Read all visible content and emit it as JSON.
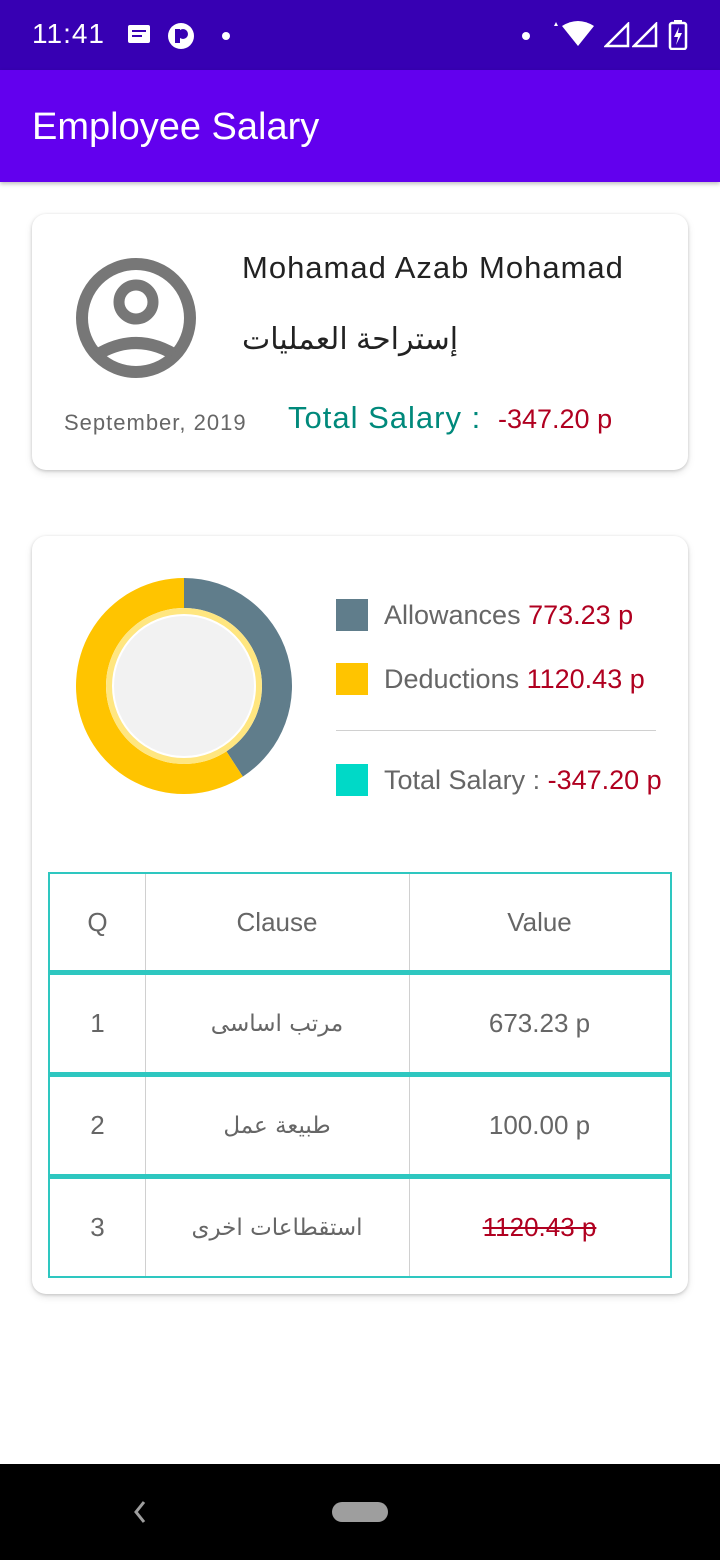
{
  "status_bar": {
    "time": "11:41",
    "left_icons": [
      "message-icon",
      "pocket-icon",
      "dot-icon"
    ],
    "right_icons": [
      "dot-icon",
      "wifi-icon",
      "signal-icon",
      "signal-icon",
      "battery-charging-icon"
    ]
  },
  "app_bar": {
    "title": "Employee Salary"
  },
  "employee": {
    "name": "Mohamad Azab Mohamad",
    "department": "إستراحة العمليات",
    "period": "September, 2019",
    "total_label": "Total Salary :",
    "total_value": "-347.20 p"
  },
  "chart_data": {
    "type": "pie",
    "donut": true,
    "series": [
      {
        "name": "Allowances",
        "value": 773.23,
        "color": "#607d8b"
      },
      {
        "name": "Deductions",
        "value": 1120.43,
        "color": "#ffc400"
      }
    ]
  },
  "legend": {
    "allowances_label": "Allowances",
    "allowances_value": "773.23 p",
    "deductions_label": "Deductions",
    "deductions_value": "1120.43 p",
    "total_label": "Total Salary :",
    "total_value": "-347.20 p",
    "total_color": "#00d9c7"
  },
  "table": {
    "headers": [
      "Q",
      "Clause",
      "Value"
    ],
    "rows": [
      {
        "q": "1",
        "clause": "مرتب اساسى",
        "value": "673.23 p",
        "struck": false
      },
      {
        "q": "2",
        "clause": "طبيعة عمل",
        "value": "100.00 p",
        "struck": false
      },
      {
        "q": "3",
        "clause": "استقطاعات اخرى",
        "value": "1120.43 p",
        "struck": true
      }
    ]
  },
  "colors": {
    "status_bar": "#3700b3",
    "app_bar": "#6200ee",
    "accent_teal": "#00897b",
    "negative_red": "#b00020",
    "table_border": "#2ec7c0"
  }
}
